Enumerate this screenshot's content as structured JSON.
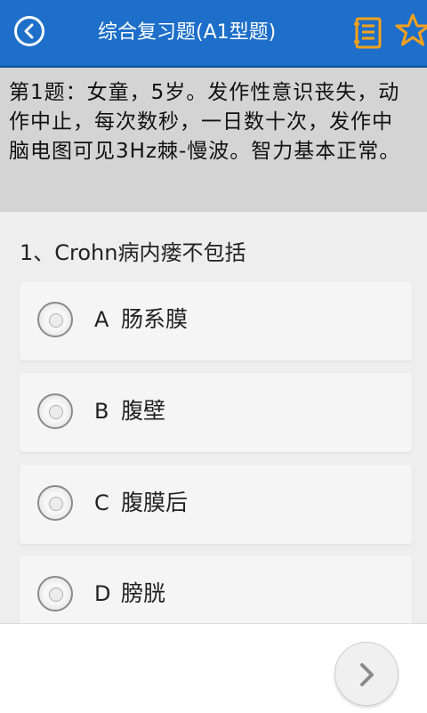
{
  "header": {
    "title": "综合复习题(A1型题)",
    "back_icon": "back-circle-icon",
    "notes_icon": "notebook-icon",
    "star_icon": "star-icon"
  },
  "stem": {
    "text": "第1题：女童，5岁。发作性意识丧失，动作中止，每次数秒，一日数十次，发作中脑电图可见3Hz棘-慢波。智力基本正常。"
  },
  "question": {
    "text": "1、Crohn病内瘘不包括"
  },
  "options": [
    {
      "letter": "A",
      "text": "肠系膜"
    },
    {
      "letter": "B",
      "text": "腹壁"
    },
    {
      "letter": "C",
      "text": "腹膜后"
    },
    {
      "letter": "D",
      "text": "膀胱"
    }
  ],
  "footer": {
    "next_icon": "chevron-right-icon"
  },
  "colors": {
    "header_bg": "#1d6fc9",
    "stem_bg": "#d4d4d4",
    "page_bg": "#eeeeee",
    "icon_accent": "#f7a11a"
  }
}
